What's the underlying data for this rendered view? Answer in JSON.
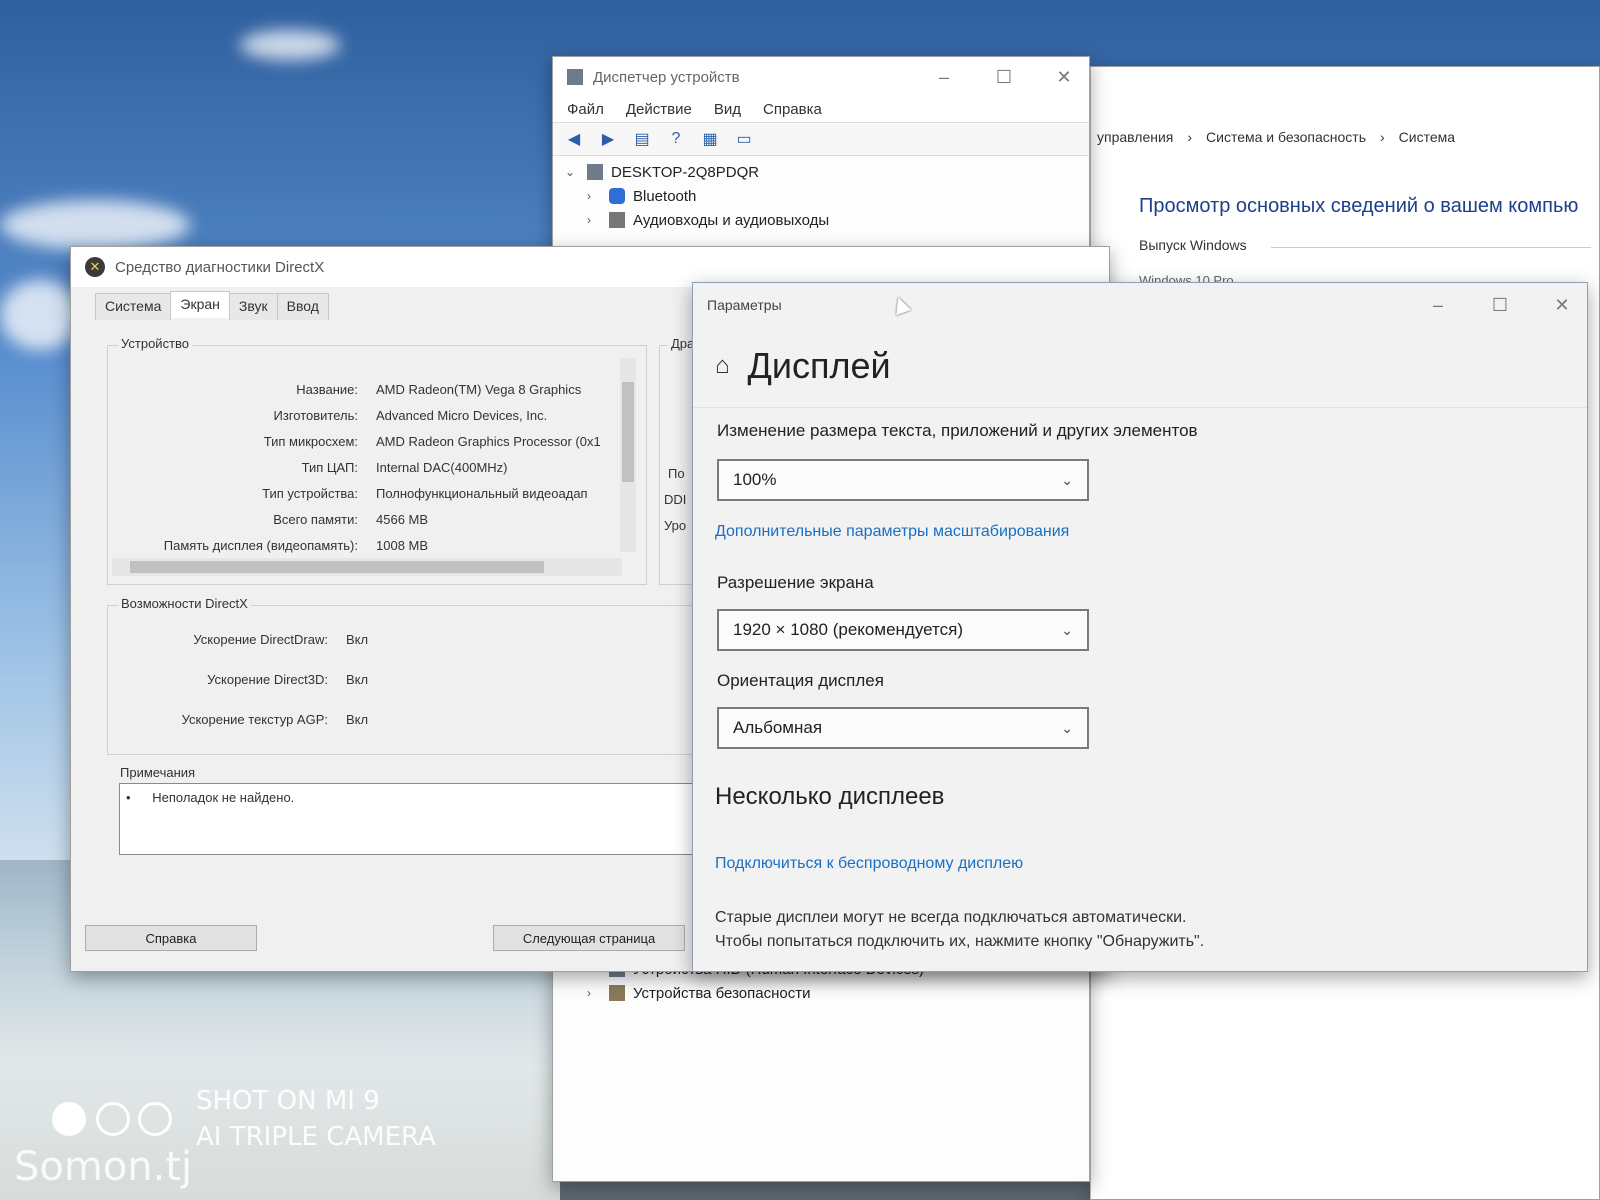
{
  "device_manager": {
    "title": "Диспетчер устройств",
    "menu": [
      "Файл",
      "Действие",
      "Вид",
      "Справка"
    ],
    "tree_root": "DESKTOP-2Q8PDQR",
    "tree_items_top": [
      "Bluetooth",
      "Аудиовходы и аудиовыходы"
    ],
    "tree_items_bottom": [
      "Устройства HID (Human Interface Devices)",
      "Устройства безопасности"
    ]
  },
  "control_panel": {
    "breadcrumb": [
      "управления",
      "Система и безопасность",
      "Система"
    ],
    "heading": "Просмотр основных сведений о вашем компью",
    "section": "Выпуск Windows",
    "edition": "Windows 10 Pro"
  },
  "dxdiag": {
    "title": "Средство диагностики DirectX",
    "tabs": [
      "Система",
      "Экран",
      "Звук",
      "Ввод"
    ],
    "device_group": "Устройство",
    "driver_group_partial": "Дра",
    "device_rows": [
      {
        "key": "Название:",
        "value": "AMD Radeon(TM) Vega 8 Graphics"
      },
      {
        "key": "Изготовитель:",
        "value": "Advanced Micro Devices, Inc."
      },
      {
        "key": "Тип микросхем:",
        "value": "AMD Radeon Graphics Processor (0x1"
      },
      {
        "key": "Тип ЦАП:",
        "value": "Internal DAC(400MHz)"
      },
      {
        "key": "Тип устройства:",
        "value": "Полнофункциональный видеоадап"
      },
      {
        "key": "Всего памяти:",
        "value": "4566 MB"
      },
      {
        "key": "Память дисплея (видеопамять):",
        "value": "1008 MB"
      }
    ],
    "driver_partial": [
      "По",
      "DDI",
      "Уро"
    ],
    "features_group": "Возможности DirectX",
    "features": [
      {
        "key": "Ускорение DirectDraw:",
        "value": "Вкл"
      },
      {
        "key": "Ускорение Direct3D:",
        "value": "Вкл"
      },
      {
        "key": "Ускорение текстур AGP:",
        "value": "Вкл"
      }
    ],
    "notes_group": "Примечания",
    "notes": "Неполадок не найдено.",
    "btn_help": "Справка",
    "btn_next": "Следующая страница"
  },
  "settings": {
    "window_title": "Параметры",
    "page_title": "Дисплей",
    "scale_label": "Изменение размера текста, приложений и других элементов",
    "scale_value": "100%",
    "scale_link": "Дополнительные параметры масштабирования",
    "resolution_label": "Разрешение экрана",
    "resolution_value": "1920 × 1080 (рекомендуется)",
    "orientation_label": "Ориентация дисплея",
    "orientation_value": "Альбомная",
    "multi_heading": "Несколько дисплеев",
    "wireless_link": "Подключиться к беспроводному дисплею",
    "hint_line1": "Старые дисплеи могут не всегда подключаться автоматически.",
    "hint_line2": "Чтобы попытаться подключить их, нажмите кнопку \"Обнаружить\"."
  },
  "watermark": {
    "line1": "SHOT ON MI 9",
    "line2": "AI TRIPLE CAMERA",
    "site": "Somon.tj"
  }
}
